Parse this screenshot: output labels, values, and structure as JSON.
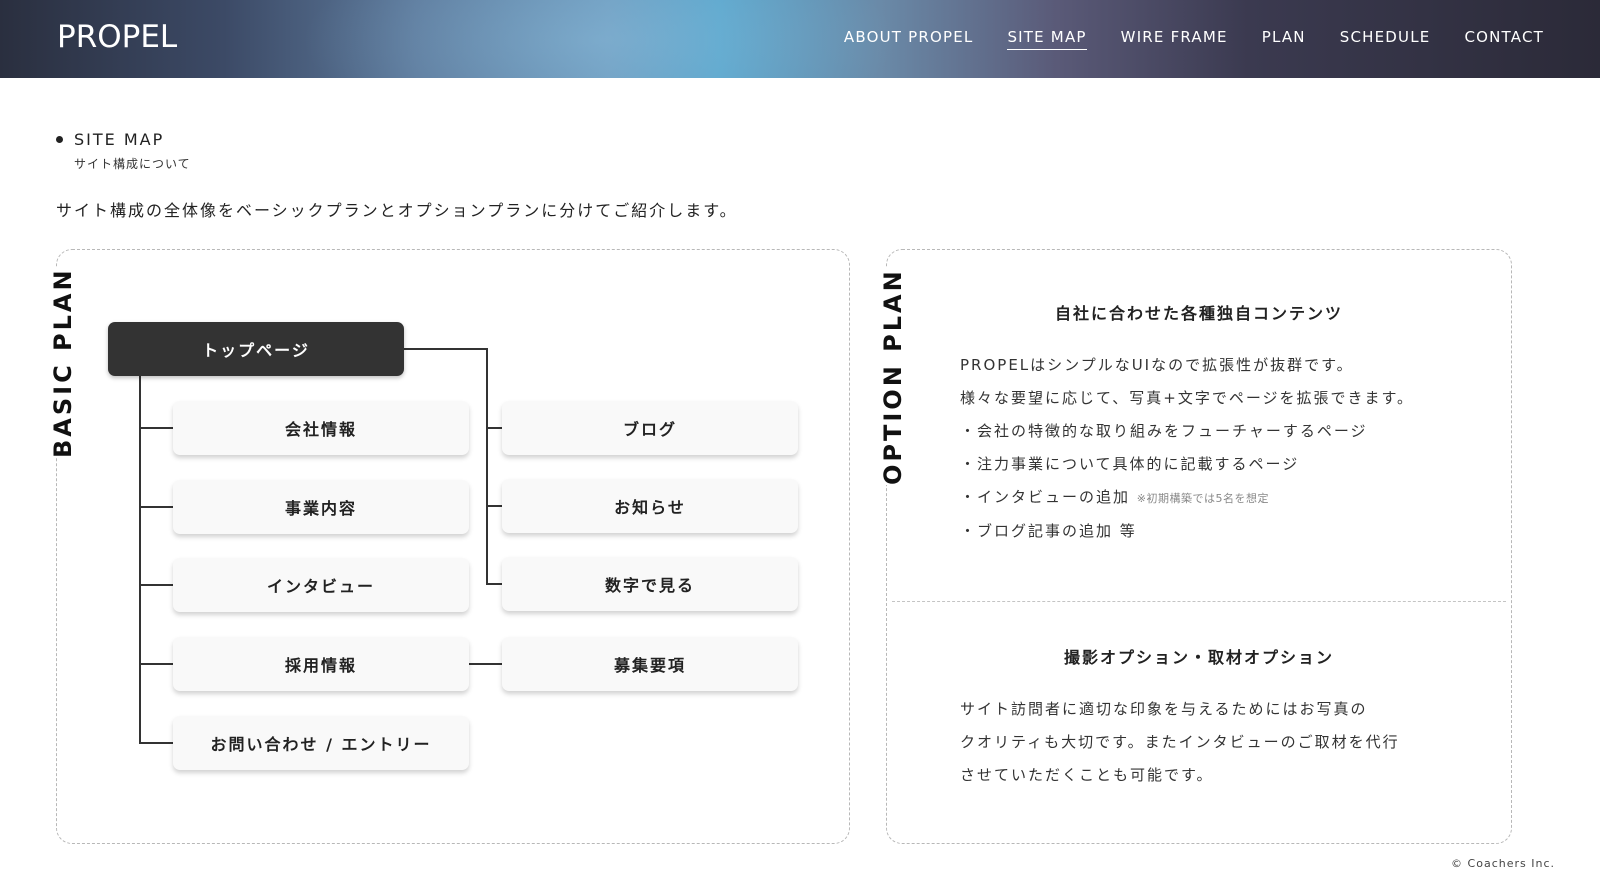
{
  "header": {
    "logo": "PROPEL",
    "nav": [
      "ABOUT PROPEL",
      "SITE MAP",
      "WIRE FRAME",
      "PLAN",
      "SCHEDULE",
      "CONTACT"
    ],
    "active": "SITE MAP"
  },
  "section": {
    "title": "SITE MAP",
    "subtitle": "サイト構成について",
    "lead": "サイト構成の全体像をベーシックプランとオプションプランに分けてご紹介します。"
  },
  "basic": {
    "label": "BASIC PLAN",
    "top": "トップページ",
    "left_items": [
      "会社情報",
      "事業内容",
      "インタビュー",
      "採用情報",
      "お問い合わせ / エントリー"
    ],
    "right_items": [
      "ブログ",
      "お知らせ",
      "数字で見る",
      "募集要項"
    ]
  },
  "option": {
    "label": "OPTION PLAN",
    "block1": {
      "title": "自社に合わせた各種独自コンテンツ",
      "lines": [
        "PROPELはシンプルなUIなので拡張性が抜群です。",
        "様々な要望に応じて、写真+文字でページを拡張できます。",
        "・会社の特徴的な取り組みをフューチャーするページ",
        "・注力事業について具体的に記載するページ",
        "・インタビューの追加",
        "・ブログ記事の追加 等"
      ],
      "note": "※初期構築では5名を想定"
    },
    "block2": {
      "title": "撮影オプション・取材オプション",
      "lines": [
        "サイト訪問者に適切な印象を与えるためにはお写真の",
        "クオリティも大切です。またインタビューのご取材を代行",
        "させていただくことも可能です。"
      ]
    }
  },
  "footer": {
    "copyright": "© Coachers Inc."
  }
}
